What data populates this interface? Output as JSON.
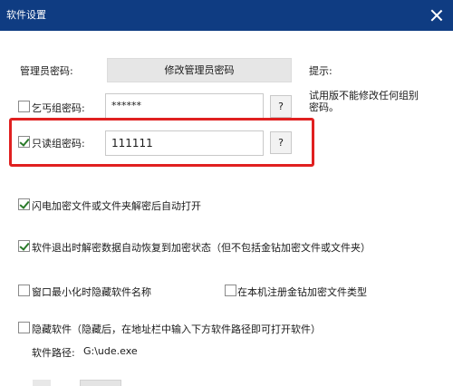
{
  "window": {
    "title": "软件设置"
  },
  "admin": {
    "label": "管理员密码:",
    "button_label": "修改管理员密码"
  },
  "hint": {
    "title": "提示:",
    "text_line1": "试用版不能修改任何组别",
    "text_line2": "密码。"
  },
  "beggar": {
    "label": "乞丐组密码:",
    "value": "******",
    "help_label": "?",
    "checked": false
  },
  "readonly": {
    "label": "只读组密码:",
    "value": "111111",
    "help_label": "?",
    "checked": true
  },
  "options": {
    "flash_open": {
      "label": "闪电加密文件或文件夹解密后自动打开",
      "checked": true
    },
    "auto_restore": {
      "label": "软件退出时解密数据自动恢复到加密状态（但不包括金钻加密文件或文件夹）",
      "checked": true
    },
    "minimize_hide": {
      "label": "窗口最小化时隐藏软件名称",
      "checked": false
    },
    "register_type": {
      "label": "在本机注册金钻加密文件类型",
      "checked": false
    },
    "hide_software": {
      "label": "隐藏软件（隐藏后，在地址栏中输入下方软件路径即可打开软件）",
      "checked": false
    }
  },
  "path": {
    "label": "软件路径:",
    "value": "G:\\ude.exe"
  },
  "colors": {
    "titlebar": "#0f3c82",
    "highlight": "#e02020",
    "check": "#2a7a2a"
  }
}
